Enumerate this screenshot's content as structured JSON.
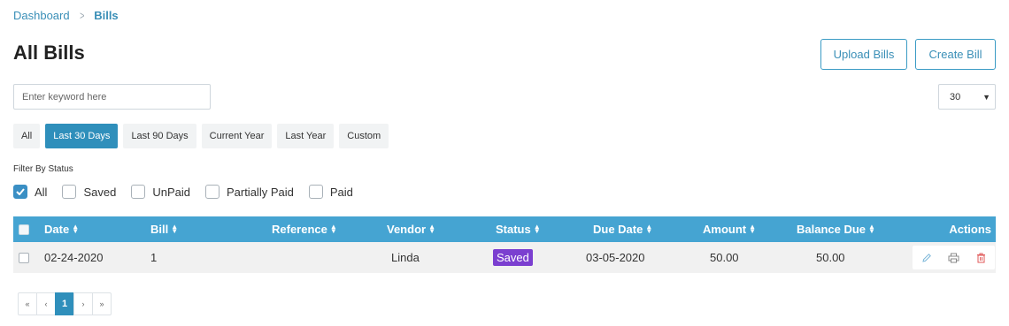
{
  "breadcrumb": {
    "home": "Dashboard",
    "current": "Bills"
  },
  "page": {
    "title": "All Bills"
  },
  "buttons": {
    "upload": "Upload Bills",
    "create": "Create Bill"
  },
  "search": {
    "placeholder": "Enter keyword here",
    "value": ""
  },
  "per_page": {
    "selected": "30"
  },
  "period_tabs": [
    {
      "label": "All",
      "active": false
    },
    {
      "label": "Last 30 Days",
      "active": true
    },
    {
      "label": "Last 90 Days",
      "active": false
    },
    {
      "label": "Current Year",
      "active": false
    },
    {
      "label": "Last Year",
      "active": false
    },
    {
      "label": "Custom",
      "active": false
    }
  ],
  "status_filter": {
    "label": "Filter By Status",
    "options": [
      {
        "label": "All",
        "checked": true
      },
      {
        "label": "Saved",
        "checked": false
      },
      {
        "label": "UnPaid",
        "checked": false
      },
      {
        "label": "Partially Paid",
        "checked": false
      },
      {
        "label": "Paid",
        "checked": false
      }
    ]
  },
  "table": {
    "headers": {
      "date": "Date",
      "bill": "Bill",
      "reference": "Reference",
      "vendor": "Vendor",
      "status": "Status",
      "due_date": "Due Date",
      "amount": "Amount",
      "balance_due": "Balance Due",
      "actions": "Actions"
    },
    "rows": [
      {
        "date": "02-24-2020",
        "bill": "1",
        "reference": "",
        "vendor": "Linda",
        "status": "Saved",
        "due_date": "03-05-2020",
        "amount": "50.00",
        "balance_due": "50.00"
      }
    ]
  },
  "pagination": {
    "first": "«",
    "prev": "‹",
    "current": "1",
    "next": "›",
    "last": "»"
  },
  "colors": {
    "accent": "#2f8fbb",
    "table_header": "#45a4d2",
    "status_saved": "#7b3fd0",
    "delete_icon": "#e05a5a"
  },
  "icons": {
    "breadcrumb_separator": "chevron-right-icon",
    "select_caret": "caret-down-icon",
    "edit": "pencil-icon",
    "print": "print-icon",
    "delete": "trash-icon",
    "sort": "sort-icon"
  }
}
